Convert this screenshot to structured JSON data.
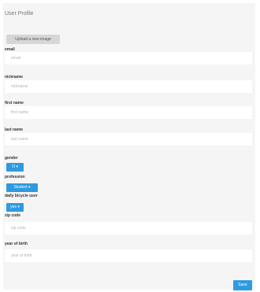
{
  "page": {
    "title": "User Profile"
  },
  "upload": {
    "label": "Upload a new image"
  },
  "fields": {
    "email": {
      "label": "email",
      "placeholder": "email",
      "value": ""
    },
    "nickname": {
      "label": "nickname",
      "placeholder": "nickname",
      "value": ""
    },
    "first_name": {
      "label": "first name",
      "placeholder": "first name",
      "value": ""
    },
    "last_name": {
      "label": "last name",
      "placeholder": "last name",
      "value": ""
    },
    "zip_code": {
      "label": "zip code",
      "placeholder": "zip code",
      "value": ""
    },
    "year_of_birth": {
      "label": "year of birth",
      "placeholder": "year of birth",
      "value": ""
    }
  },
  "selects": {
    "gender": {
      "label": "gender",
      "selected": "O ▾"
    },
    "profession": {
      "label": "profession",
      "selected": "Student ▾"
    },
    "daily_bicycle_user": {
      "label": "daily bicycle user",
      "selected": "yes ▾"
    }
  },
  "actions": {
    "save_label": "Save"
  },
  "colors": {
    "accent": "#2e9be0",
    "background": "#f5f5f5",
    "field": "#ffffff",
    "upload_button": "#d6d6d6"
  }
}
